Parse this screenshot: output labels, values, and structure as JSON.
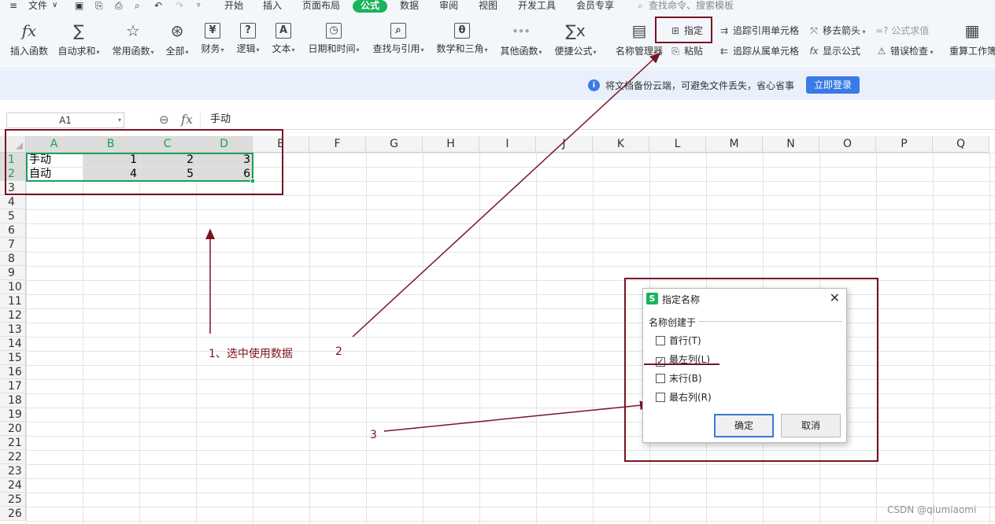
{
  "menubar": {
    "items": [
      {
        "label": "文件",
        "state": "normal"
      },
      {
        "label": "开始",
        "state": "normal"
      },
      {
        "label": "插入",
        "state": "normal"
      },
      {
        "label": "页面布局",
        "state": "normal"
      },
      {
        "label": "公式",
        "state": "active"
      },
      {
        "label": "数据",
        "state": "normal"
      },
      {
        "label": "审阅",
        "state": "normal"
      },
      {
        "label": "视图",
        "state": "normal"
      },
      {
        "label": "开发工具",
        "state": "normal"
      },
      {
        "label": "会员专享",
        "state": "normal"
      }
    ],
    "search_placeholder": "查找命令、搜索模板"
  },
  "ribbon": {
    "big_buttons": [
      {
        "label": "插入函数",
        "icon": "fx-icon",
        "glyph": "fx",
        "dropdown": false
      },
      {
        "label": "自动求和",
        "icon": "sum-icon",
        "glyph": "∑",
        "dropdown": true
      },
      {
        "label": "常用函数",
        "icon": "star-icon",
        "glyph": "☆",
        "dropdown": true
      },
      {
        "label": "全部",
        "icon": "all-functions-icon",
        "glyph": "⊛",
        "dropdown": true
      },
      {
        "label": "财务",
        "icon": "finance-icon",
        "glyph": "¥",
        "dropdown": true
      },
      {
        "label": "逻辑",
        "icon": "logic-icon",
        "glyph": "?",
        "dropdown": true
      },
      {
        "label": "文本",
        "icon": "text-icon",
        "glyph": "A",
        "dropdown": true
      },
      {
        "label": "日期和时间",
        "icon": "clock-icon",
        "glyph": "◷",
        "dropdown": true
      },
      {
        "label": "查找与引用",
        "icon": "lookup-icon",
        "glyph": "⌕",
        "dropdown": true
      },
      {
        "label": "数学和三角",
        "icon": "math-icon",
        "glyph": "θ",
        "dropdown": true
      },
      {
        "label": "其他函数",
        "icon": "more-functions-icon",
        "glyph": "∘∘∘",
        "dropdown": true
      },
      {
        "label": "便捷公式",
        "icon": "quick-formula-icon",
        "glyph": "∑x",
        "dropdown": true
      },
      {
        "label": "名称管理器",
        "icon": "name-manager-icon",
        "glyph": "▤",
        "dropdown": false
      }
    ],
    "small_buttons": [
      {
        "label": "指定",
        "icon": "specify-icon",
        "glyph": "⊞",
        "dim": false
      },
      {
        "label": "粘贴",
        "icon": "paste-icon",
        "glyph": "⎘",
        "dim": false
      },
      {
        "label": "追踪引用单元格",
        "icon": "trace-precedents-icon",
        "glyph": "⇉",
        "dim": false
      },
      {
        "label": "追踪从属单元格",
        "icon": "trace-dependents-icon",
        "glyph": "⇇",
        "dim": false
      },
      {
        "label": "移去箭头",
        "icon": "remove-arrows-icon",
        "glyph": "⤧",
        "dim": false
      },
      {
        "label": "显示公式",
        "icon": "show-formulas-icon",
        "glyph": "fx",
        "dim": false
      },
      {
        "label": "=? 公式求值",
        "icon": "evaluate-formula-icon",
        "glyph": "",
        "dim": true
      },
      {
        "label": "错误检查",
        "icon": "error-check-icon",
        "glyph": "⚠",
        "dim": false
      },
      {
        "label": "重算工作簿",
        "icon": "recalculate-icon",
        "glyph": "▦",
        "dim": false
      }
    ]
  },
  "notice": {
    "text": "将文档备份云端，可避免文件丢失，省心省事",
    "button": "立即登录"
  },
  "formula_bar": {
    "name_box": "A1",
    "content": "手动"
  },
  "sheet": {
    "columns": [
      "A",
      "B",
      "C",
      "D",
      "E",
      "F",
      "G",
      "H",
      "I",
      "J",
      "K",
      "L",
      "M",
      "N",
      "O",
      "P",
      "Q"
    ],
    "selected_columns": [
      "A",
      "B",
      "C",
      "D"
    ],
    "row_count": 26,
    "selected_rows": [
      1,
      2
    ],
    "cells": [
      {
        "row": 1,
        "col": "A",
        "value": "手动",
        "kind": "txt"
      },
      {
        "row": 1,
        "col": "B",
        "value": "1",
        "kind": "num"
      },
      {
        "row": 1,
        "col": "C",
        "value": "2",
        "kind": "num"
      },
      {
        "row": 1,
        "col": "D",
        "value": "3",
        "kind": "num"
      },
      {
        "row": 2,
        "col": "A",
        "value": "自动",
        "kind": "txt"
      },
      {
        "row": 2,
        "col": "B",
        "value": "4",
        "kind": "num"
      },
      {
        "row": 2,
        "col": "C",
        "value": "5",
        "kind": "num"
      },
      {
        "row": 2,
        "col": "D",
        "value": "6",
        "kind": "num"
      }
    ]
  },
  "annotations": {
    "step1": "1、选中使用数据",
    "step2": "2",
    "step3": "3",
    "color": "#7a1422"
  },
  "dialog": {
    "title": "指定名称",
    "group_label": "名称创建于",
    "options": [
      {
        "label": "首行(T)",
        "checked": false
      },
      {
        "label": "最左列(L)",
        "checked": true
      },
      {
        "label": "末行(B)",
        "checked": false
      },
      {
        "label": "最右列(R)",
        "checked": false
      }
    ],
    "ok": "确定",
    "cancel": "取消"
  },
  "watermark": "CSDN @qiumiaomi",
  "colors": {
    "accent": "#19b35a",
    "link_blue": "#3b7ae6",
    "annotation": "#7a1422"
  }
}
